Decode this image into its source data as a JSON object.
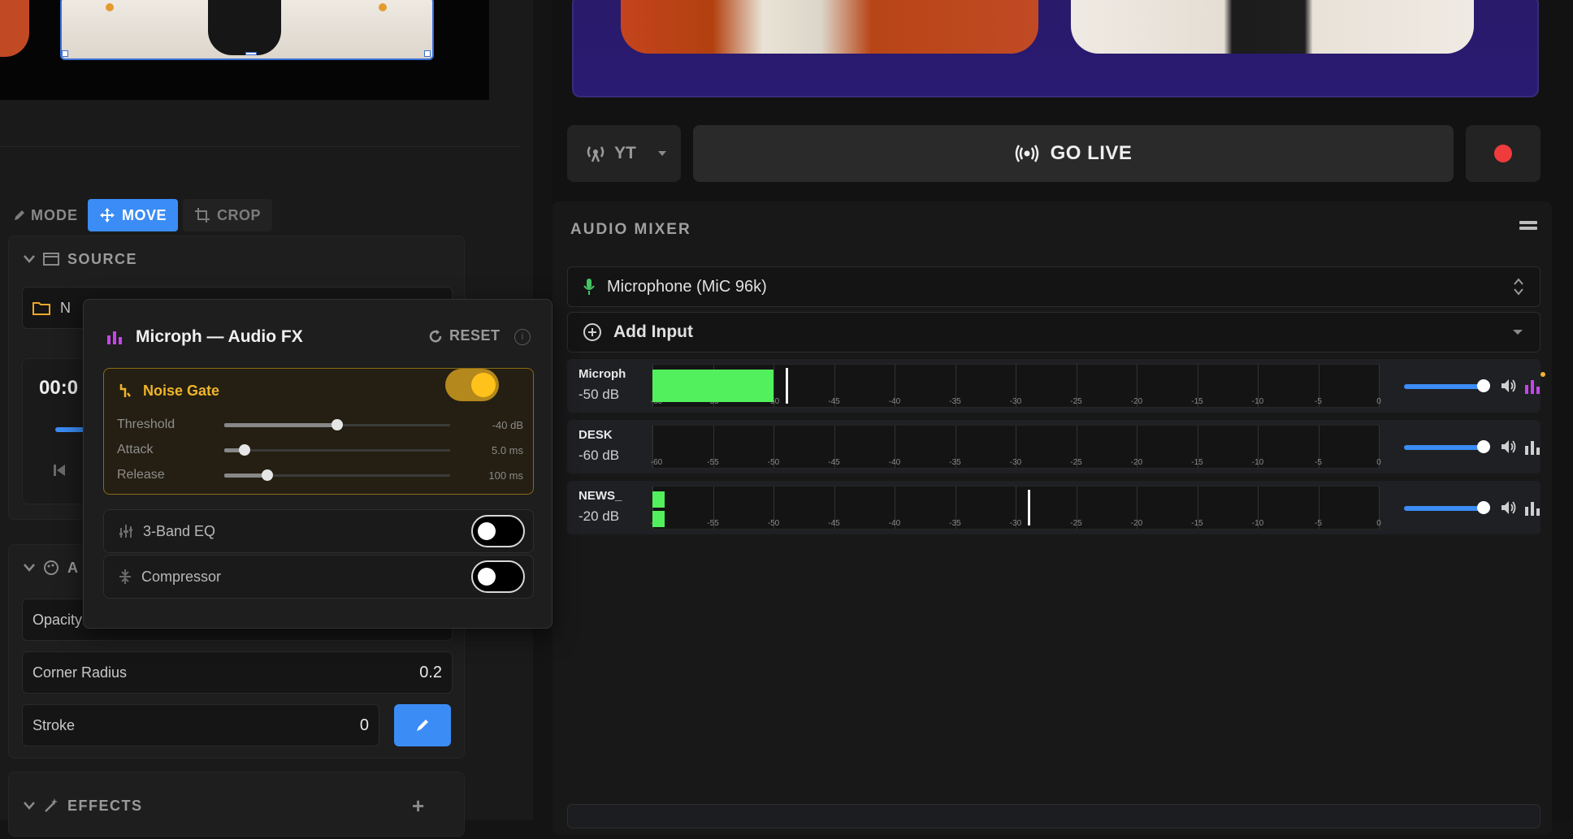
{
  "left": {
    "mode_label": "MODE",
    "move_label": "MOVE",
    "crop_label": "CROP",
    "source_heading": "SOURCE",
    "source_value_partial": "N",
    "time_partial": "00:0",
    "appearance_heading_partial": "A",
    "opacity_label": "Opacity",
    "corner_radius_label": "Corner Radius",
    "corner_radius_value": "0.2",
    "stroke_label": "Stroke",
    "stroke_value": "0",
    "effects_heading": "EFFECTS",
    "effects_add": "+"
  },
  "stream": {
    "platform": "YT",
    "go_live_label": "GO LIVE"
  },
  "mixer": {
    "title": "AUDIO MIXER",
    "selected_input": "Microphone (MiC 96k)",
    "add_input_label": "Add Input",
    "scale_labels": [
      "-60",
      "-55",
      "-50",
      "-45",
      "-40",
      "-35",
      "-30",
      "-25",
      "-20",
      "-15",
      "-10",
      "-5",
      "0"
    ],
    "channels": [
      {
        "name": "Microph",
        "db": "-50 dB",
        "level_db": -50,
        "peak_db": -49,
        "volume": 0.82,
        "fx_active": true
      },
      {
        "name": "DESK",
        "db": "-60 dB",
        "level_db": -60,
        "peak_db": null,
        "volume": 0.82,
        "fx_active": false
      },
      {
        "name": "NEWS_",
        "db": "-20 dB",
        "level_db": -59,
        "peak_db": -29,
        "volume": 0.82,
        "fx_active": false
      }
    ]
  },
  "fx_popup": {
    "title": "Microph — Audio FX",
    "reset_label": "RESET",
    "info_glyph": "i",
    "noise_gate": {
      "label": "Noise Gate",
      "enabled": true,
      "threshold_label": "Threshold",
      "threshold_value": "-40 dB",
      "threshold_pos": 0.5,
      "attack_label": "Attack",
      "attack_value": "5.0 ms",
      "attack_pos": 0.09,
      "release_label": "Release",
      "release_value": "100 ms",
      "release_pos": 0.19
    },
    "eq_label": "3-Band EQ",
    "eq_enabled": false,
    "compressor_label": "Compressor",
    "compressor_enabled": false
  },
  "colors": {
    "accent": "#3b8cf5",
    "meter_green": "#52f05c",
    "gate_gold": "#f0b52a",
    "record_red": "#ef3b3b",
    "fx_purple": "#c347e8"
  }
}
